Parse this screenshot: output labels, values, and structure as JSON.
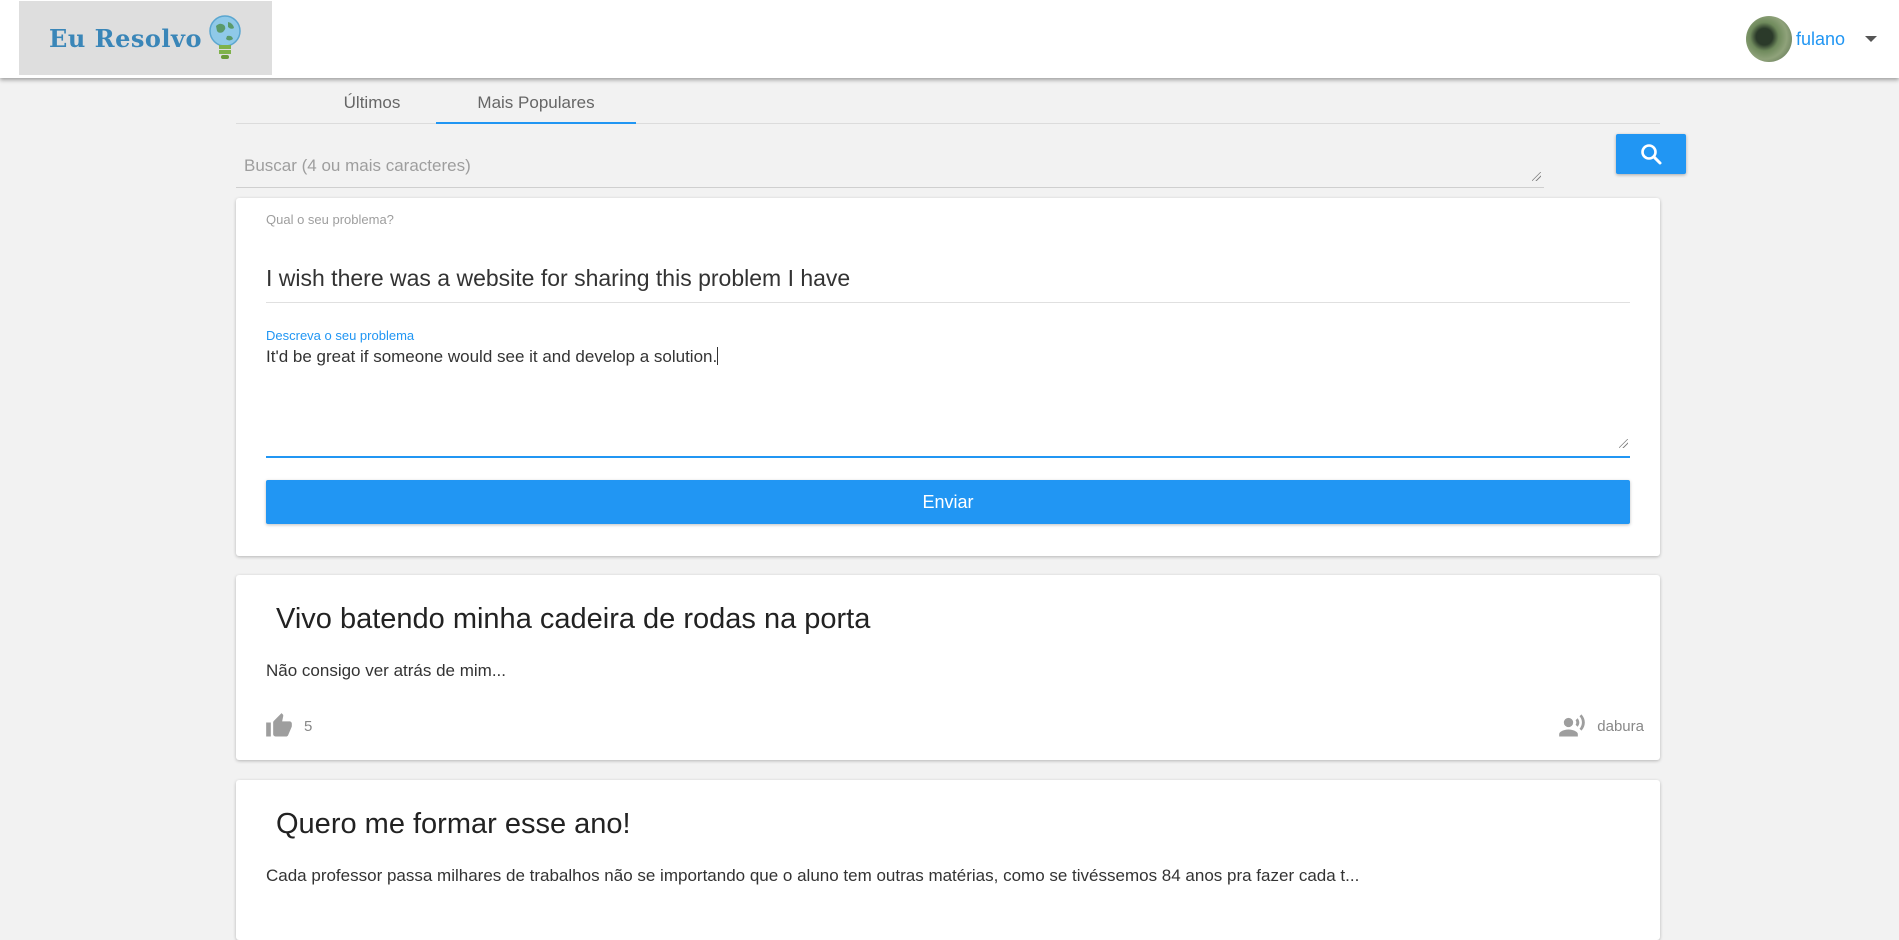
{
  "header": {
    "logo_text": "Eu Resolvo",
    "username": "fulano"
  },
  "tabs": [
    {
      "label": "Últimos",
      "active": false
    },
    {
      "label": "Mais Populares",
      "active": true
    }
  ],
  "search": {
    "placeholder": "Buscar (4 ou mais caracteres)",
    "value": ""
  },
  "form": {
    "title_label": "Qual o seu problema?",
    "title_value": "I wish there was a website for sharing this problem I have",
    "description_label": "Descreva o seu problema",
    "description_value": "It'd be great if someone would see it and develop a solution.",
    "submit_label": "Enviar"
  },
  "posts": [
    {
      "title": "Vivo batendo minha cadeira de rodas na porta",
      "body": "Não consigo ver atrás de mim...",
      "likes": "5",
      "author": "dabura"
    },
    {
      "title": "Quero me formar esse ano!",
      "body": "Cada professor passa milhares de trabalhos não se importando que o aluno tem outras matérias, como se tivéssemos 84 anos pra fazer cada t..."
    }
  ],
  "colors": {
    "accent": "#2196f3",
    "background": "#f2f2f2"
  },
  "icons": [
    "lightbulb-globe-icon",
    "chevron-down-icon",
    "search-icon",
    "thumb-up-icon",
    "person-speaking-icon"
  ]
}
